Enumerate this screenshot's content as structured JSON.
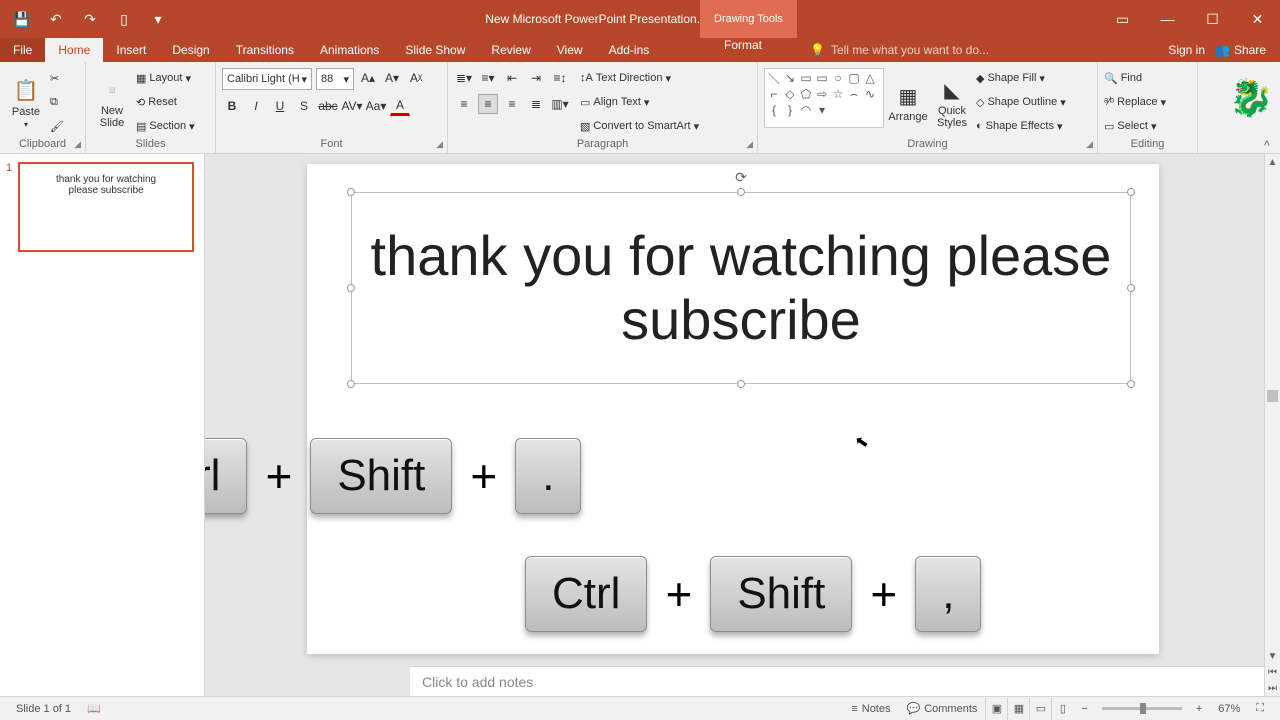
{
  "titlebar": {
    "doc_title": "New Microsoft PowerPoint Presentation.pptx - PowerPoint",
    "tool_context": "Drawing Tools"
  },
  "window_controls": {
    "ribbon_opts": "▭",
    "min": "—",
    "max": "☐",
    "close": "✕"
  },
  "qat": {
    "save": "💾",
    "undo": "↶",
    "redo": "↷",
    "start": "▯",
    "more": "▾"
  },
  "tabs": {
    "file": "File",
    "home": "Home",
    "insert": "Insert",
    "design": "Design",
    "transitions": "Transitions",
    "animations": "Animations",
    "slideshow": "Slide Show",
    "review": "Review",
    "view": "View",
    "addins": "Add-ins",
    "format": "Format",
    "tellme_placeholder": "Tell me what you want to do...",
    "signin": "Sign in",
    "share": "Share"
  },
  "ribbon": {
    "clipboard": {
      "label": "Clipboard",
      "paste": "Paste"
    },
    "slides": {
      "label": "Slides",
      "newslide": "New\nSlide",
      "layout": "Layout",
      "reset": "Reset",
      "section": "Section"
    },
    "font": {
      "label": "Font",
      "name": "Calibri Light (H",
      "size": "88"
    },
    "paragraph": {
      "label": "Paragraph",
      "textdir": "Text Direction",
      "align": "Align Text",
      "smartart": "Convert to SmartArt"
    },
    "drawing": {
      "label": "Drawing",
      "arrange": "Arrange",
      "quick": "Quick\nStyles",
      "fill": "Shape Fill",
      "outline": "Shape Outline",
      "effects": "Shape Effects"
    },
    "editing": {
      "label": "Editing",
      "find": "Find",
      "replace": "Replace",
      "select": "Select"
    }
  },
  "thumb": {
    "number": "1",
    "line1": "thank you for watching",
    "line2": "please subscribe"
  },
  "slide": {
    "text": "thank you for watching please subscribe"
  },
  "shortcuts": {
    "row1": {
      "k1": "Ctrl",
      "k2": "Shift",
      "k3": "."
    },
    "row2": {
      "k1": "Ctrl",
      "k2": "Shift",
      "k3": ","
    },
    "plus": "+"
  },
  "notes": {
    "placeholder": "Click to add notes"
  },
  "status": {
    "slide": "Slide 1 of 1",
    "notes": "Notes",
    "comments": "Comments",
    "zoom_pct": "67%",
    "zoom_minus": "−",
    "zoom_plus": "+"
  }
}
